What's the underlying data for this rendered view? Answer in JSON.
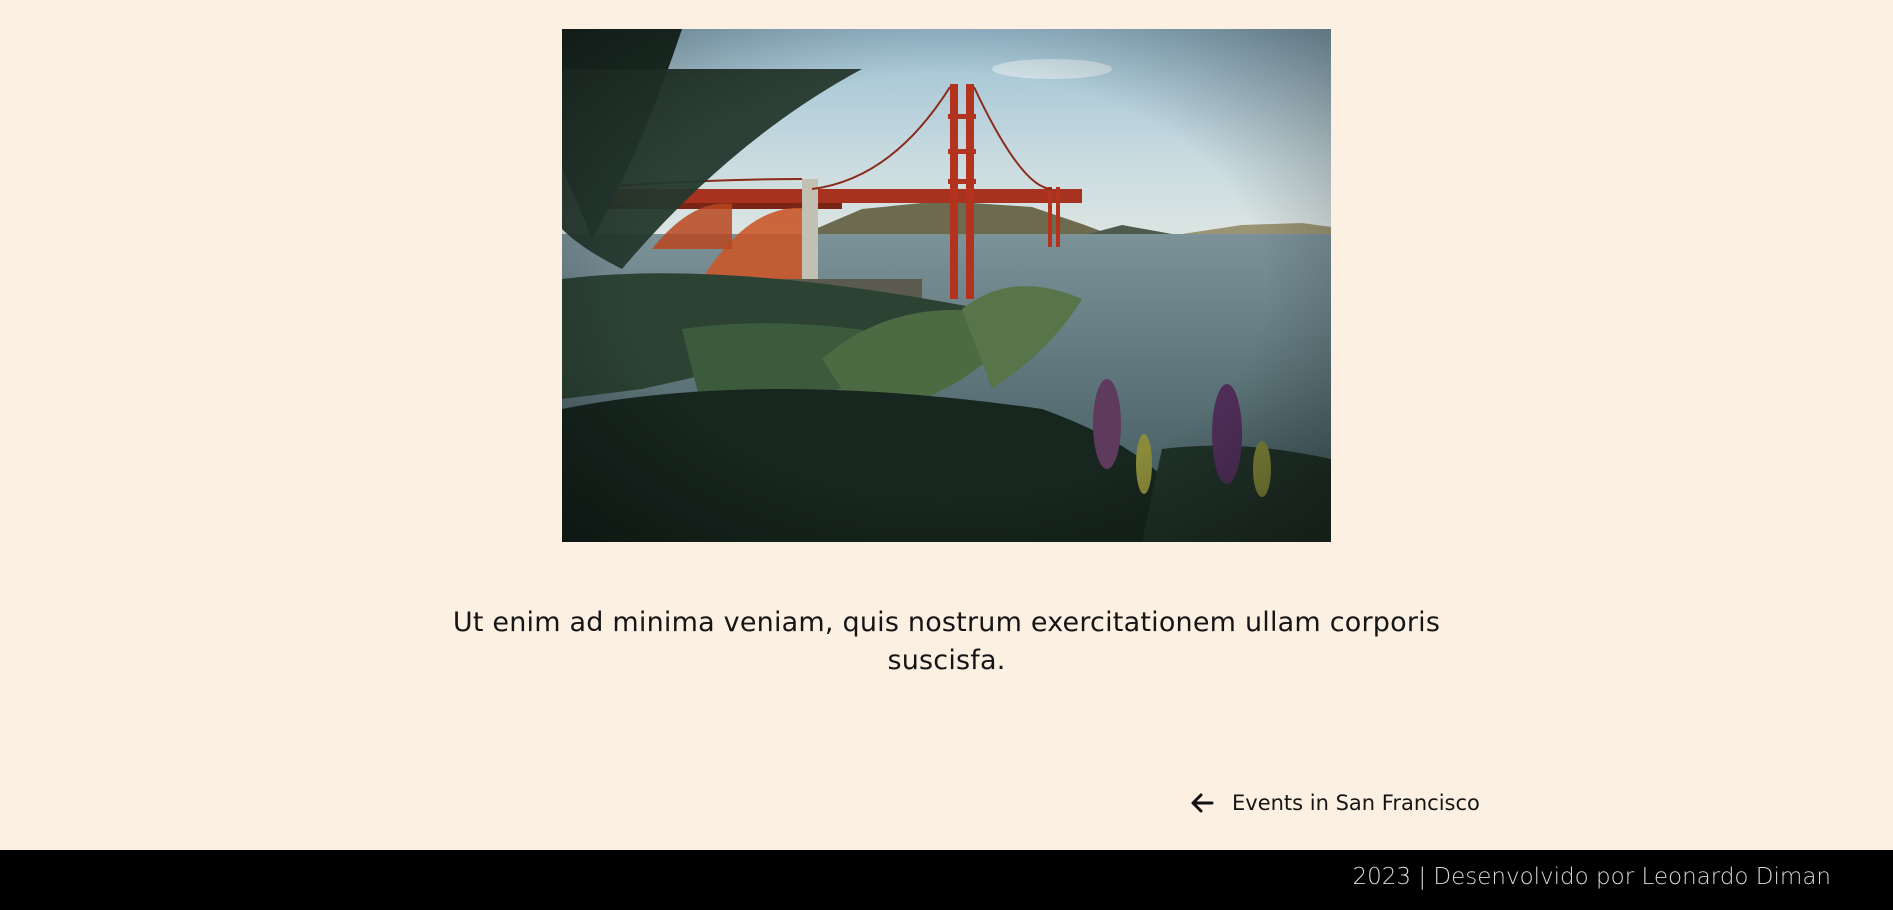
{
  "hero": {
    "image_alt": "Golden Gate Bridge viewed through plants"
  },
  "article": {
    "caption": "Ut enim ad minima veniam, quis nostrum exercitationem ullam corporis suscisfa."
  },
  "navigation": {
    "back_icon": "arrow-left-icon",
    "back_label": "Events in San Francisco"
  },
  "footer": {
    "text": "2023 | Desenvolvido por Leonardo Diman"
  },
  "colors": {
    "page_background": "#fbf0e2",
    "footer_background": "#000000",
    "bridge": "#b3331f"
  }
}
